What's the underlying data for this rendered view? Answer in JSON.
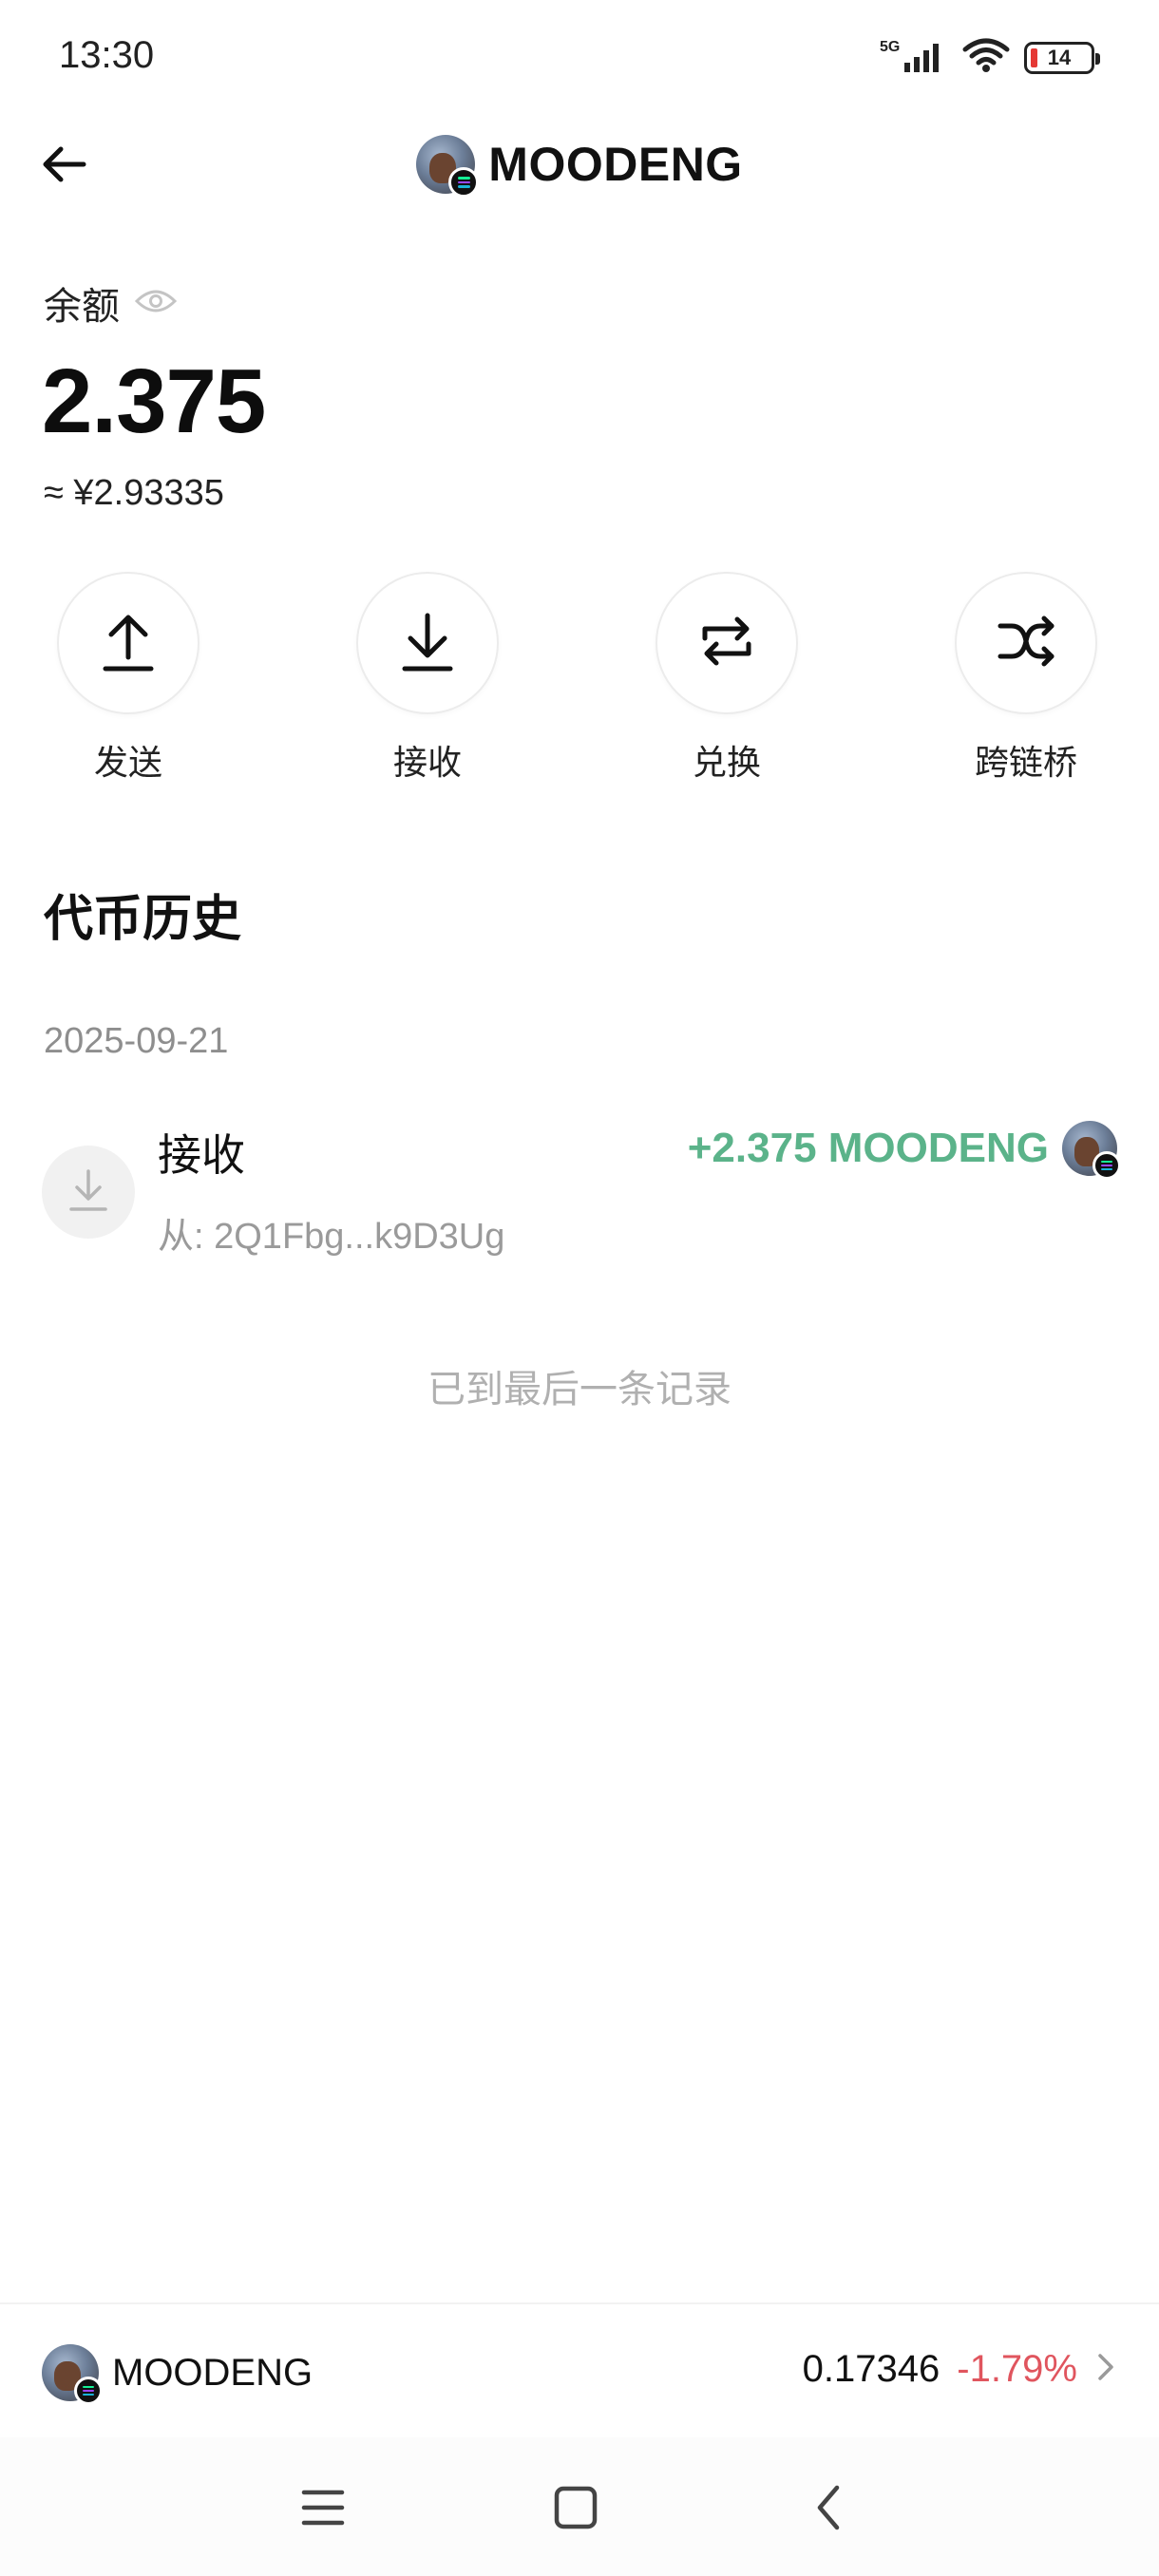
{
  "status_bar": {
    "time": "13:30",
    "network": "5G",
    "battery": "14"
  },
  "header": {
    "title": "MOODENG",
    "back_icon": "arrow-left-icon"
  },
  "balance": {
    "label": "余额",
    "value": "2.375",
    "fiat": "≈ ¥2.93335"
  },
  "actions": [
    {
      "label": "发送",
      "icon": "upload-icon"
    },
    {
      "label": "接收",
      "icon": "download-icon"
    },
    {
      "label": "兑换",
      "icon": "swap-icon"
    },
    {
      "label": "跨链桥",
      "icon": "shuffle-icon"
    }
  ],
  "history": {
    "title": "代币历史",
    "groups": [
      {
        "date": "2025-09-21",
        "transactions": [
          {
            "type": "接收",
            "from": "从: 2Q1Fbg...k9D3Ug",
            "amount": "+2.375 MOODENG"
          }
        ]
      }
    ],
    "end_note": "已到最后一条记录"
  },
  "ticker": {
    "name": "MOODENG",
    "price": "0.17346",
    "change": "-1.79%"
  },
  "colors": {
    "positive": "#5bb38a",
    "negative": "#e0555e",
    "muted": "#9a9a9a",
    "chain_stripe_1": "#14f195",
    "chain_stripe_2": "#9945ff",
    "chain_stripe_3": "#19b3d8"
  }
}
